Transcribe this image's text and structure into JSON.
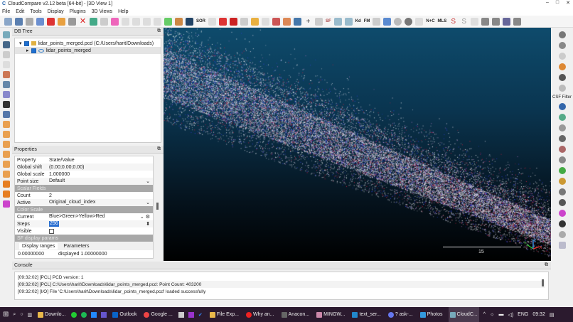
{
  "window": {
    "title": "CloudCompare v2.12 beta [64-bit] - [3D View 1]",
    "controls": [
      "–",
      "□",
      "✕"
    ]
  },
  "menu": [
    "File",
    "Edit",
    "Tools",
    "Display",
    "Plugins",
    "3D Views",
    "Help"
  ],
  "toolbar": {
    "labels": [
      "SOR",
      "SF",
      "Kd",
      "FM",
      "N+C",
      "MLS"
    ]
  },
  "db_tree": {
    "title": "DB Tree",
    "items": [
      {
        "label": "lidar_points_merged.pcd (C:/Users/harit/Downloads)"
      },
      {
        "label": "lidar_points_merged"
      }
    ]
  },
  "properties": {
    "title": "Properties",
    "header": {
      "k": "Property",
      "v": "State/Value"
    },
    "rows1": [
      {
        "k": "Global shift",
        "v": "(0.00;0.00;0.00)"
      },
      {
        "k": "Global scale",
        "v": "1.000000"
      },
      {
        "k": "Point size",
        "v": "Default"
      }
    ],
    "sec_scalar": "Scalar Fields",
    "rows2": [
      {
        "k": "Count",
        "v": "2"
      },
      {
        "k": "Active",
        "v": "Original_cloud_index"
      }
    ],
    "sec_color": "Color Scale",
    "rows3": [
      {
        "k": "Current",
        "v": "Blue>Green>Yellow>Red"
      },
      {
        "k": "Steps",
        "v": "256"
      },
      {
        "k": "Visible",
        "v": ""
      }
    ],
    "sec_sf": "SF display params",
    "tabs": [
      "Display ranges",
      "Parameters"
    ],
    "range_left": "0.00000000",
    "range_right": "displayed   1.00000000"
  },
  "view": {
    "scale_label": "15",
    "axes": [
      "X",
      "Y",
      "Z"
    ]
  },
  "right_panel": {
    "csf_label": "CSF Filter"
  },
  "console": {
    "title": "Console",
    "lines": [
      "[09:32:02] [PCL] PCD version: 1",
      "[09:32:02] [PCL] C:\\Users\\harit\\Downloads\\lidar_points_merged.pcd: Point Count: 403200",
      "[09:32:02] [I/O] File 'C:\\Users\\harit\\Downloads\\lidar_points_merged.pcd' loaded successfully"
    ]
  },
  "taskbar": {
    "apps": [
      "Downlo...",
      "Outlook",
      "Google ...",
      "File Exp...",
      "Why an...",
      "Anacon...",
      "MINGW...",
      "text_ser...",
      "? ask-...",
      "Photos",
      "CloudC..."
    ],
    "lang": "ENG",
    "time": "09:32"
  }
}
